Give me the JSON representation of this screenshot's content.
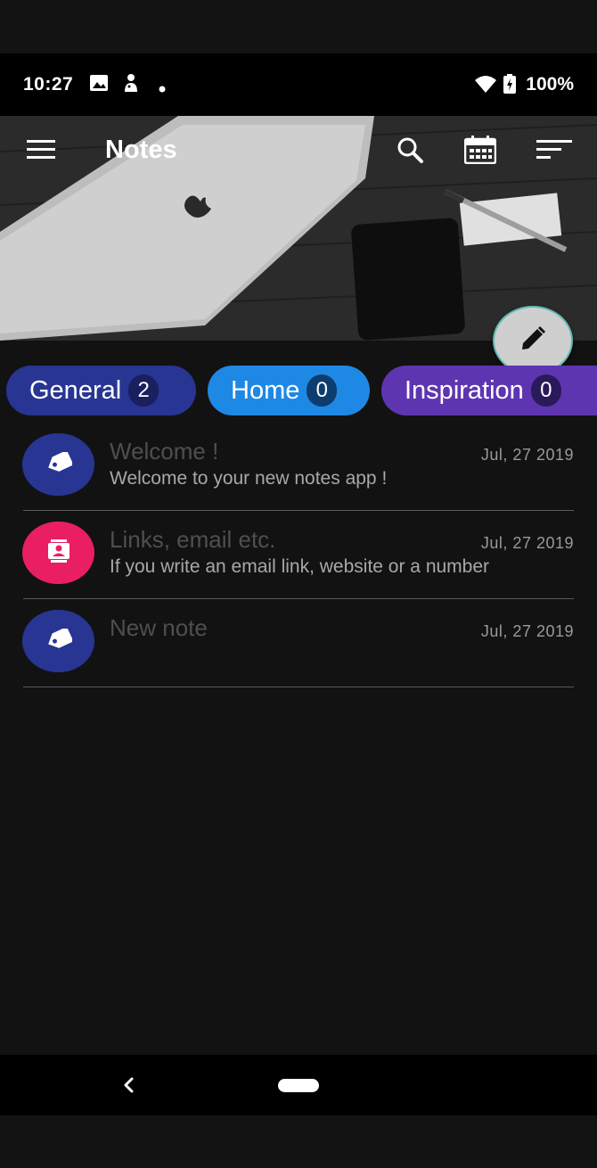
{
  "status_bar": {
    "time": "10:27",
    "battery": "100%",
    "icons": [
      "image-icon",
      "accessibility-icon",
      "dot-icon",
      "wifi-icon",
      "battery-charging-icon"
    ]
  },
  "appbar": {
    "title": "Notes",
    "actions": [
      "search-icon",
      "calendar-icon",
      "sort-icon"
    ],
    "menu_icon": "menu-icon"
  },
  "fab": {
    "icon": "pencil-icon",
    "color": "#cfcfcf"
  },
  "categories": [
    {
      "label": "General",
      "count": "2",
      "color": "#283593",
      "count_bg": "#1a1f5e"
    },
    {
      "label": "Home",
      "count": "0",
      "color": "#1e88e5",
      "count_bg": "#0d3d6e"
    },
    {
      "label": "Inspiration",
      "count": "0",
      "color": "#5e35b1",
      "count_bg": "#2b1a5a"
    }
  ],
  "notes": [
    {
      "title": "Welcome !",
      "date": "Jul, 27 2019",
      "body": "Welcome to your new notes app !",
      "icon": "tag-icon",
      "color": "#283593"
    },
    {
      "title": "Links, email etc.",
      "date": "Jul, 27 2019",
      "body": "If you write an email link, website or a number",
      "icon": "contact-card-icon",
      "color": "#e91e63"
    },
    {
      "title": "New note",
      "date": "Jul, 27 2019",
      "body": "",
      "icon": "tag-icon",
      "color": "#283593"
    }
  ],
  "nav": {
    "back_icon": "back-icon",
    "home_icon": "home-pill-icon"
  }
}
